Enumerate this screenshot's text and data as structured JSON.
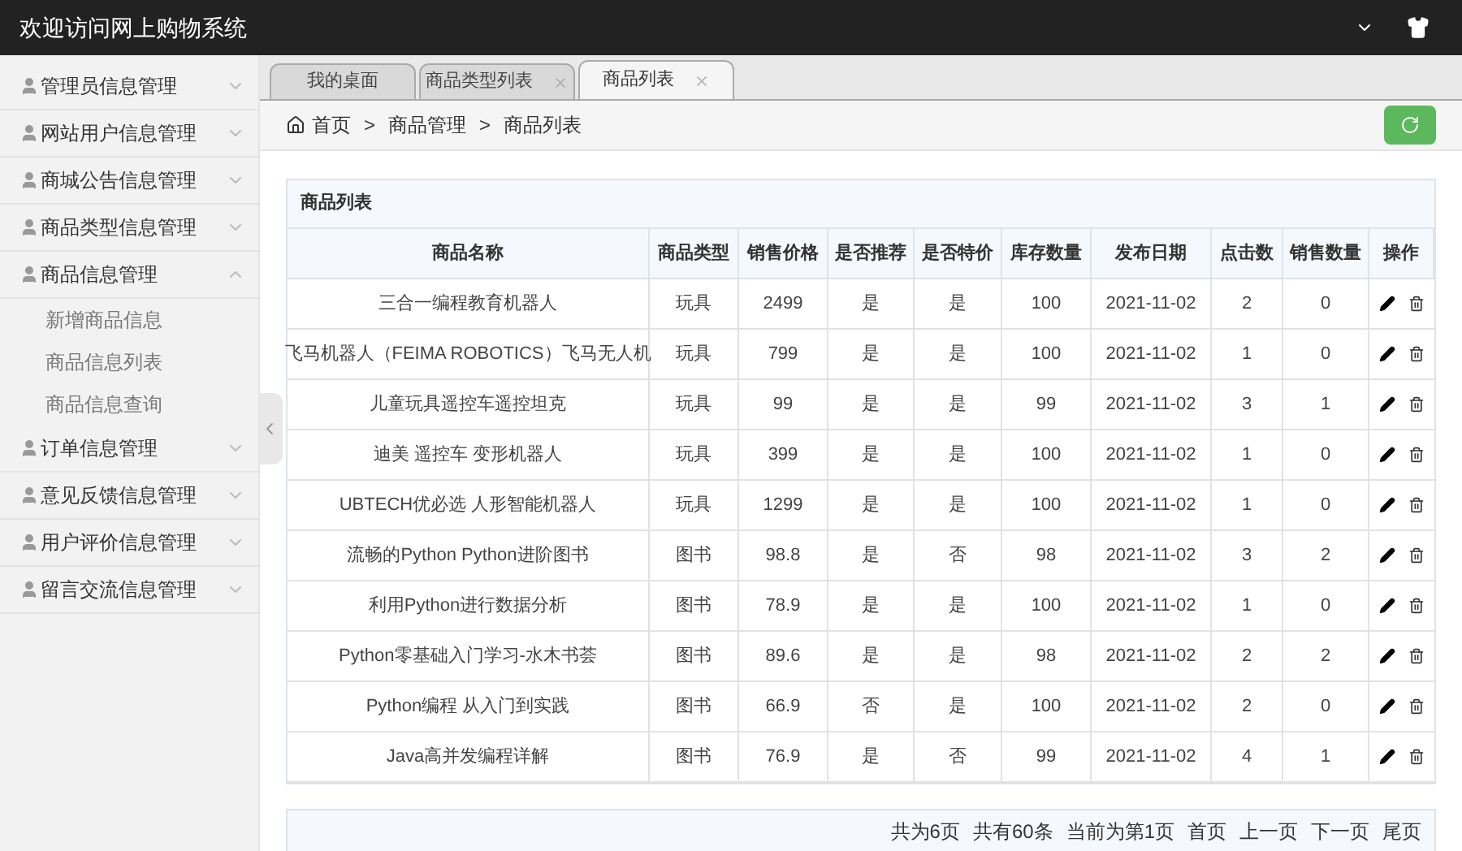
{
  "header": {
    "title": "欢迎访问网上购物系统"
  },
  "sidebar": {
    "items": [
      {
        "label": "管理员信息管理",
        "expanded": false
      },
      {
        "label": "网站用户信息管理",
        "expanded": false
      },
      {
        "label": "商城公告信息管理",
        "expanded": false
      },
      {
        "label": "商品类型信息管理",
        "expanded": false
      },
      {
        "label": "商品信息管理",
        "expanded": true,
        "children": [
          {
            "label": "新增商品信息"
          },
          {
            "label": "商品信息列表"
          },
          {
            "label": "商品信息查询"
          }
        ]
      },
      {
        "label": "订单信息管理",
        "expanded": false
      },
      {
        "label": "意见反馈信息管理",
        "expanded": false
      },
      {
        "label": "用户评价信息管理",
        "expanded": false
      },
      {
        "label": "留言交流信息管理",
        "expanded": false
      }
    ]
  },
  "tabs": [
    {
      "label": "我的桌面",
      "selected": false,
      "closable": false
    },
    {
      "label": "商品类型列表",
      "selected": false,
      "closable": true
    },
    {
      "label": "商品列表",
      "selected": true,
      "closable": true
    }
  ],
  "breadcrumb": [
    {
      "kind": "link",
      "text": "首页"
    },
    {
      "kind": "separator",
      "text": ">"
    },
    {
      "kind": "link",
      "text": "商品管理"
    },
    {
      "kind": "separator",
      "text": ">"
    },
    {
      "kind": "link",
      "text": "商品列表"
    }
  ],
  "table": {
    "title": "商品列表",
    "columns": [
      "商品名称",
      "商品类型",
      "销售价格",
      "是否推荐",
      "是否特价",
      "库存数量",
      "发布日期",
      "点击数",
      "销售数量",
      "操作"
    ],
    "rows": [
      [
        "三合一编程教育机器人",
        "玩具",
        "2499",
        "是",
        "是",
        "100",
        "2021-11-02",
        "2",
        "0"
      ],
      [
        "飞马机器人（FEIMA ROBOTICS）飞马无人机",
        "玩具",
        "799",
        "是",
        "是",
        "100",
        "2021-11-02",
        "1",
        "0"
      ],
      [
        "儿童玩具遥控车遥控坦克",
        "玩具",
        "99",
        "是",
        "是",
        "99",
        "2021-11-02",
        "3",
        "1"
      ],
      [
        "迪美 遥控车 变形机器人",
        "玩具",
        "399",
        "是",
        "是",
        "100",
        "2021-11-02",
        "1",
        "0"
      ],
      [
        "UBTECH优必选 人形智能机器人",
        "玩具",
        "1299",
        "是",
        "是",
        "100",
        "2021-11-02",
        "1",
        "0"
      ],
      [
        "流畅的Python Python进阶图书",
        "图书",
        "98.8",
        "是",
        "否",
        "98",
        "2021-11-02",
        "3",
        "2"
      ],
      [
        "利用Python进行数据分析",
        "图书",
        "78.9",
        "是",
        "是",
        "100",
        "2021-11-02",
        "1",
        "0"
      ],
      [
        "Python零基础入门学习-水木书荟",
        "图书",
        "89.6",
        "是",
        "是",
        "98",
        "2021-11-02",
        "2",
        "2"
      ],
      [
        "Python编程 从入门到实践",
        "图书",
        "66.9",
        "否",
        "是",
        "100",
        "2021-11-02",
        "2",
        "0"
      ],
      [
        "Java高并发编程详解",
        "图书",
        "76.9",
        "是",
        "否",
        "99",
        "2021-11-02",
        "4",
        "1"
      ]
    ]
  },
  "pagination": [
    "共为6页",
    "共有60条",
    "当前为第1页",
    "首页",
    "上一页",
    "下一页",
    "尾页"
  ]
}
